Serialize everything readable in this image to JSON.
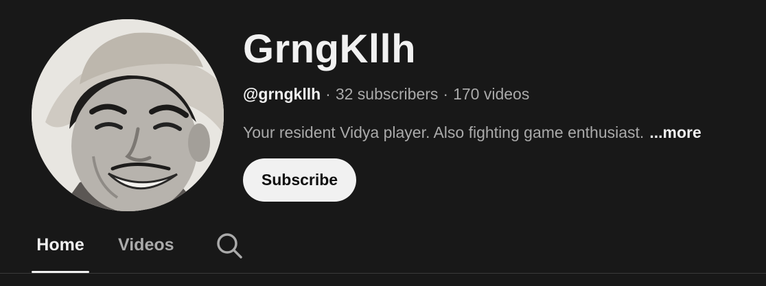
{
  "channel": {
    "name": "GrngKllh",
    "handle": "@grngkllh",
    "subscribers": "32 subscribers",
    "videos": "170 videos",
    "separator": "·",
    "description": "Your resident Vidya player. Also fighting game enthusiast.",
    "more_label": "...more",
    "avatar_icon": "channel-avatar"
  },
  "actions": {
    "subscribe_label": "Subscribe"
  },
  "tabs": [
    {
      "label": "Home",
      "selected": true
    },
    {
      "label": "Videos",
      "selected": false
    }
  ],
  "search_icon": "search-icon",
  "colors": {
    "background": "#181818",
    "text_primary": "#f1f1f1",
    "text_secondary": "#aaaaaa",
    "button_bg": "#f1f1f1",
    "button_text": "#0f0f0f"
  }
}
